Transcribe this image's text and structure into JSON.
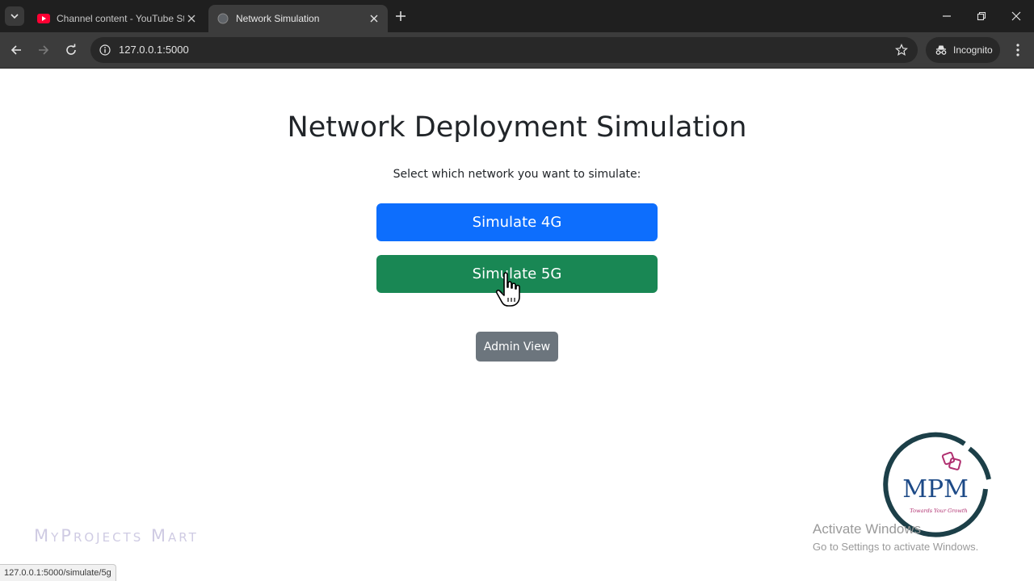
{
  "browser": {
    "tabs": [
      {
        "title": "Channel content - YouTube Stu",
        "favicon": "youtube-icon",
        "active": false
      },
      {
        "title": "Network Simulation",
        "favicon": "globe-icon",
        "active": true
      }
    ],
    "url": "127.0.0.1:5000",
    "profile_label": "Incognito",
    "status_url": "127.0.0.1:5000/simulate/5g"
  },
  "page": {
    "heading": "Network Deployment Simulation",
    "subtitle": "Select which network you want to simulate:",
    "buttons": {
      "simulate_4g": "Simulate 4G",
      "simulate_5g": "Simulate 5G",
      "admin_view": "Admin View"
    }
  },
  "overlay": {
    "watermark": "MyProjects Mart",
    "logo_text": "MPM",
    "logo_tagline": "Towards Your Growth",
    "activate_title": "Activate Windows",
    "activate_sub": "Go to Settings to activate Windows."
  },
  "colors": {
    "btn_4g": "#0d6efd",
    "btn_5g": "#198754",
    "btn_admin": "#6c757d",
    "chrome_dark": "#1f1f1f",
    "toolbar": "#3c3c3c"
  }
}
